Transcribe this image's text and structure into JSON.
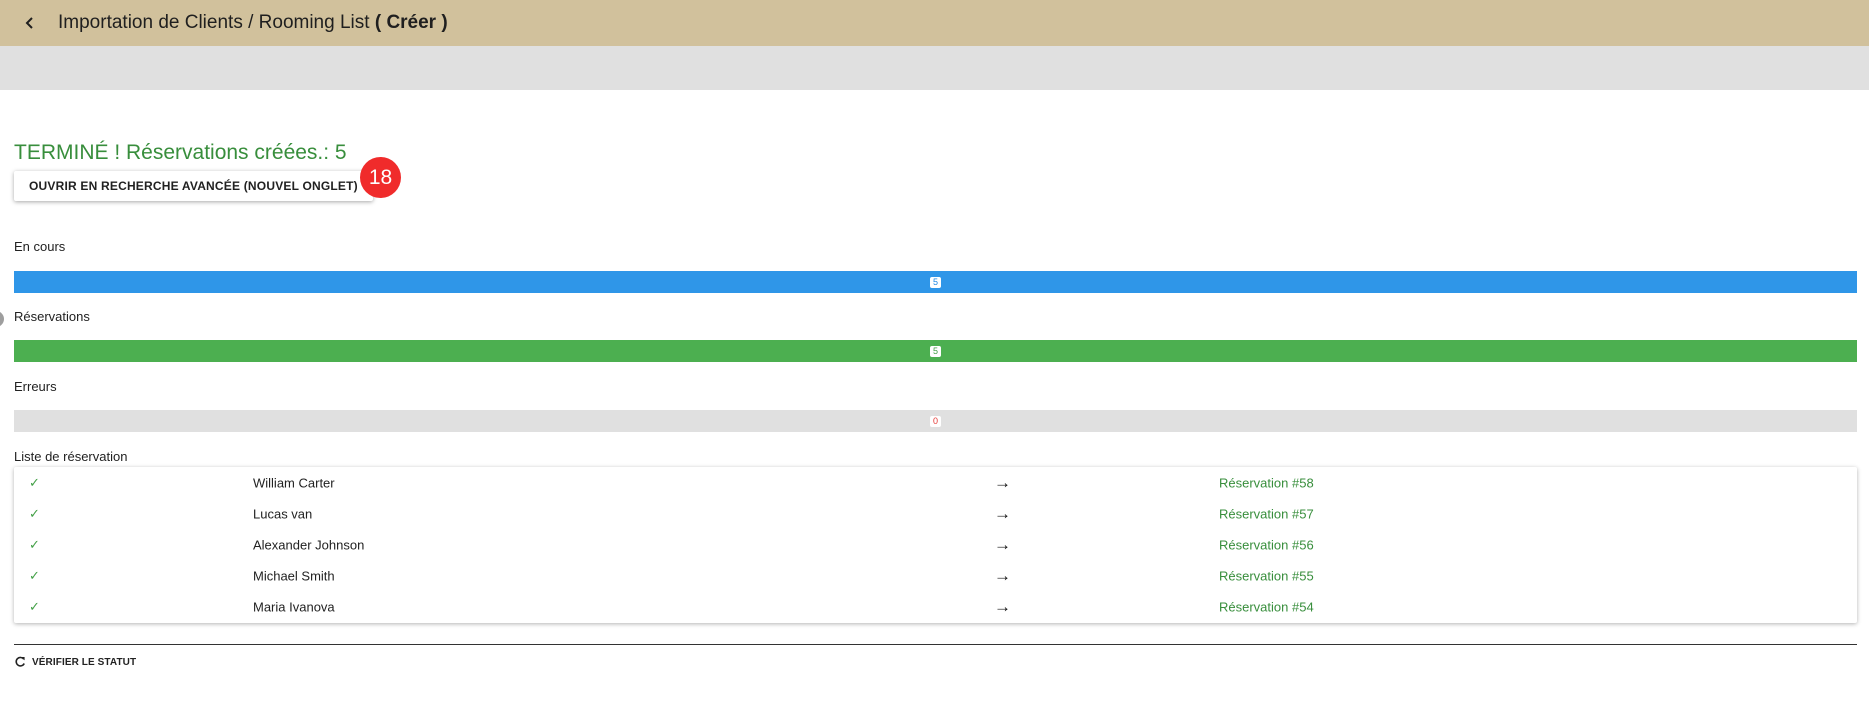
{
  "header": {
    "title_prefix": "Importation de Clients / Rooming List",
    "title_open": "(",
    "title_mode": "Créer",
    "title_close": ")"
  },
  "status": {
    "title": "TERMINÉ ! Réservations créées.: 5",
    "open_button_label": "OUVRIR EN RECHERCHE AVANCÉE (NOUVEL ONGLET)",
    "badge_count": "18"
  },
  "progress": {
    "in_progress": {
      "label": "En cours",
      "value": "5",
      "fraction": 1.0,
      "color": "#2f96e8"
    },
    "reservations": {
      "label": "Réservations",
      "value": "5",
      "fraction": 1.0,
      "color": "#4caf50"
    },
    "errors": {
      "label": "Erreurs",
      "value": "0",
      "fraction": 0.0,
      "color": "#e53935"
    }
  },
  "reservation_list": {
    "label": "Liste de réservation",
    "rows": [
      {
        "status_icon": "check-icon",
        "name": "William Carter",
        "arrow": "→",
        "reservation": "Réservation #58"
      },
      {
        "status_icon": "check-icon",
        "name": "Lucas van",
        "arrow": "→",
        "reservation": "Réservation #57"
      },
      {
        "status_icon": "check-icon",
        "name": "Alexander Johnson",
        "arrow": "→",
        "reservation": "Réservation #56"
      },
      {
        "status_icon": "check-icon",
        "name": "Michael Smith",
        "arrow": "→",
        "reservation": "Réservation #55"
      },
      {
        "status_icon": "check-icon",
        "name": "Maria Ivanova",
        "arrow": "→",
        "reservation": "Réservation #54"
      }
    ]
  },
  "footer": {
    "verify_label": "VÉRIFIER LE STATUT"
  },
  "colors": {
    "header_bg": "#d1c19c",
    "toolbar_bg": "#e0e0e0",
    "success_green": "#388e3c",
    "badge_red": "#f02b2b"
  }
}
